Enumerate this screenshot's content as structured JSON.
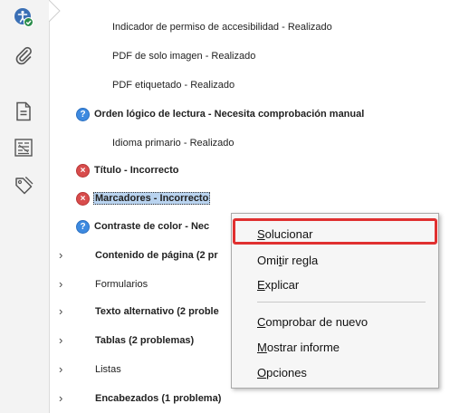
{
  "sidebar": {
    "tools": [
      {
        "name": "accessibility-check-icon"
      },
      {
        "name": "attachments-paperclip-icon"
      },
      {
        "name": "page-document-icon"
      },
      {
        "name": "content-structure-icon"
      },
      {
        "name": "tags-icon"
      }
    ]
  },
  "checker": {
    "items": [
      {
        "status": "none",
        "label": "Indicador de permiso de accesibilidad - Realizado",
        "bold": false
      },
      {
        "status": "none",
        "label": "PDF de solo imagen - Realizado",
        "bold": false
      },
      {
        "status": "none",
        "label": "PDF etiquetado - Realizado",
        "bold": false
      },
      {
        "status": "manual",
        "label": "Orden lógico de lectura - Necesita comprobación manual",
        "bold": true
      },
      {
        "status": "none",
        "label": "Idioma primario - Realizado",
        "bold": false
      },
      {
        "status": "failed",
        "label": "Título - Incorrecto",
        "bold": true
      },
      {
        "status": "failed",
        "label": "Marcadores - Incorrecto",
        "bold": true,
        "selected": true
      },
      {
        "status": "manual",
        "label": "Contraste de color - Nec",
        "bold": true
      }
    ],
    "groups": [
      {
        "label": "Contenido de página (2 pr",
        "bold": true
      },
      {
        "label": "Formularios",
        "bold": false
      },
      {
        "label": "Texto alternativo (2 proble",
        "bold": true
      },
      {
        "label": "Tablas (2 problemas)",
        "bold": true
      },
      {
        "label": "Listas",
        "bold": false
      },
      {
        "label": "Encabezados (1 problema)",
        "bold": true
      }
    ],
    "status_icons": {
      "manual": "?",
      "failed": "×"
    }
  },
  "context_menu": {
    "items": [
      {
        "pre": "",
        "key": "S",
        "post": "olucionar"
      },
      {
        "pre": "Omi",
        "key": "t",
        "post": "ir regla"
      },
      {
        "pre": "",
        "key": "E",
        "post": "xplicar"
      },
      {
        "pre": "",
        "key": "C",
        "post": "omprobar de nuevo"
      },
      {
        "pre": "",
        "key": "M",
        "post": "ostrar informe"
      },
      {
        "pre": "",
        "key": "O",
        "post": "pciones"
      }
    ]
  },
  "colors": {
    "manual_icon": "#3d8ae0",
    "failed_icon": "#d84c4c",
    "selection": "#b9d3ef",
    "focus_ring": "#e03030",
    "sidebar_icon": "#555555"
  }
}
